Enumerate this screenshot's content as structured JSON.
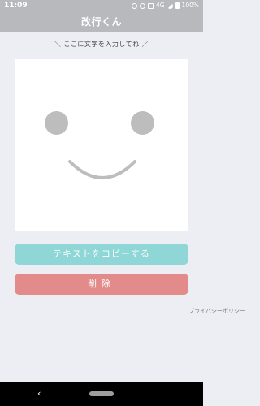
{
  "status_bar": {
    "time": "11:09",
    "network": "4G",
    "battery": "100%",
    "icons": [
      "alarm-icon",
      "eye-icon",
      "signal-icon",
      "wifi-icon",
      "battery-icon"
    ]
  },
  "app_bar": {
    "title": "改行くん"
  },
  "editor": {
    "hint": "＼ ここに文字を入力してね ／",
    "value": ""
  },
  "actions": {
    "copy_label": "テキストをコピーする",
    "delete_label": "削除"
  },
  "footer": {
    "privacy_link": "プライバシーポリシー"
  },
  "nav": {
    "back_icon": "back-chevron-icon",
    "home_icon": "home-pill-icon"
  },
  "colors": {
    "app_bar": "#b7b9bd",
    "copy_button": "#8fd6d6",
    "delete_button": "#e38a8a",
    "face": "#bdbdbd"
  }
}
